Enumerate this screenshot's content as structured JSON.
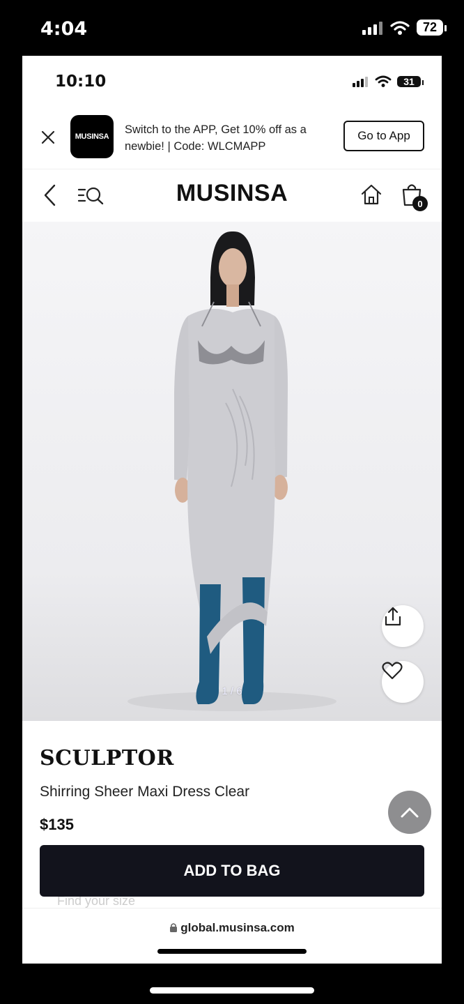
{
  "outer_status": {
    "time": "4:04",
    "battery": "72"
  },
  "inner_status": {
    "time": "10:10",
    "battery": "31"
  },
  "banner": {
    "logo_text": "MUSINSA",
    "message": "Switch to the APP, Get 10% off as a newbie! | Code: WLCMAPP",
    "button_label": "Go to App"
  },
  "nav": {
    "brand": "MUSINSA",
    "bag_count": "0"
  },
  "gallery": {
    "counter": "1 / 6"
  },
  "product": {
    "brand": "SCULPTOR",
    "name": "Shirring Sheer Maxi Dress Clear",
    "price": "$135",
    "add_to_bag_label": "ADD TO BAG",
    "find_size_label": "Find your size"
  },
  "browser": {
    "url": "global.musinsa.com"
  },
  "icons": {
    "close": "close-icon",
    "back": "chevron-left-icon",
    "menu_search": "menu-search-icon",
    "home": "home-icon",
    "bag": "shopping-bag-icon",
    "share": "share-icon",
    "heart": "heart-icon",
    "scroll_top": "chevron-up-icon",
    "lock": "lock-icon"
  },
  "colors": {
    "primary_button": "#12131c",
    "scroll_top_bg": "#8e8e90"
  }
}
